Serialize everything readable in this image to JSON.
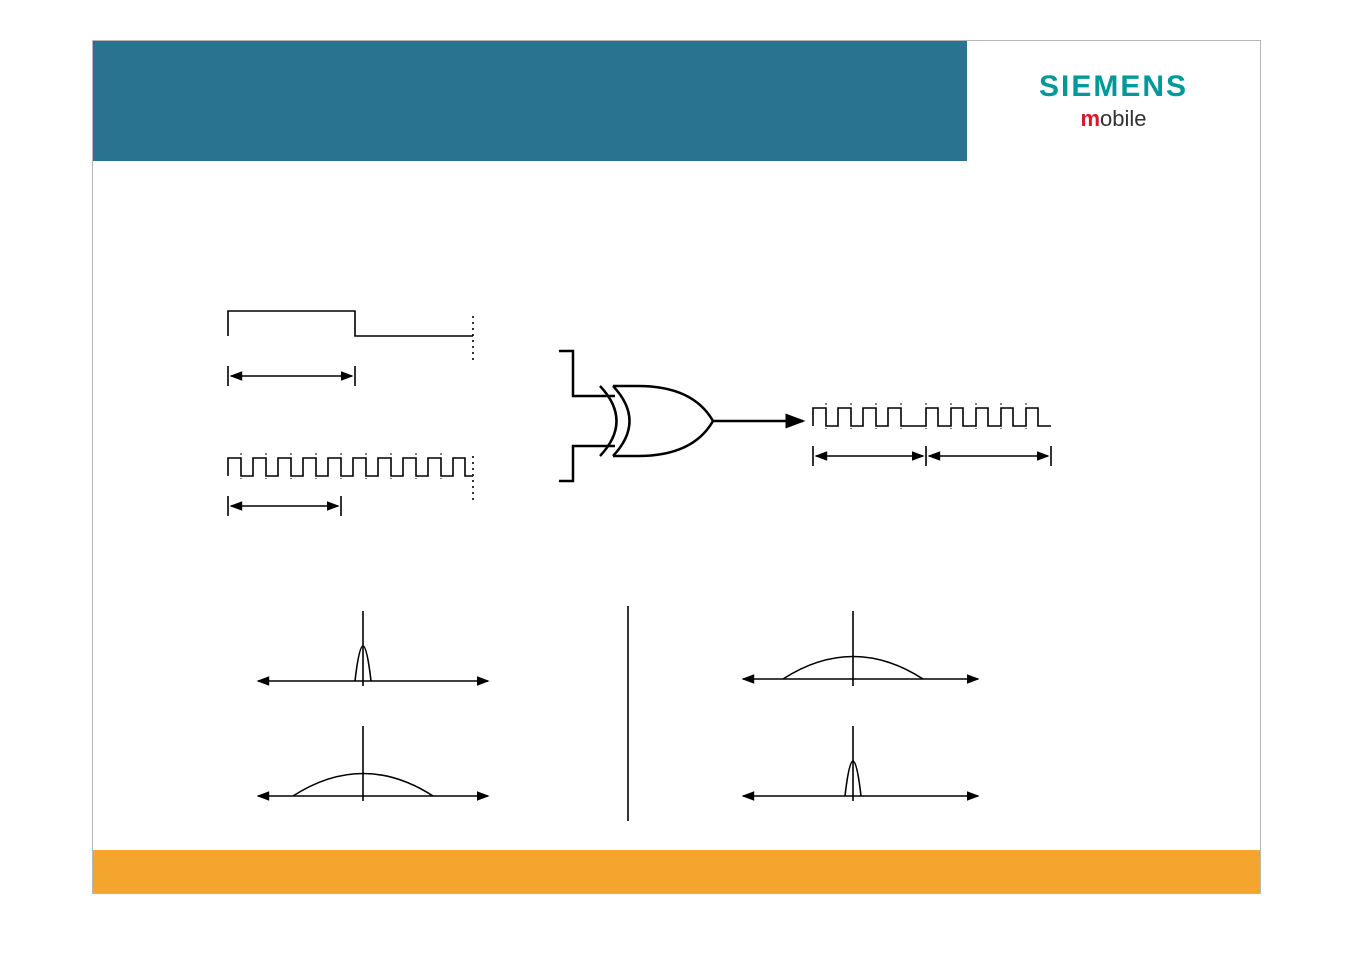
{
  "brand": {
    "line1": "SIEMENS",
    "line2_prefix": "m",
    "line2_rest": "obile"
  },
  "diagram": {
    "description": "Direct-sequence spread spectrum: a slow data bit stream is XORed with a fast chip (code) stream to produce a spread output signal; frequency-domain sketches show narrowband data / wideband code → wideband output, with receiver sketches showing wideband received / narrowband recovered.",
    "signals": {
      "input_top": {
        "role": "data-bits",
        "rate": "slow",
        "approx_chips_per_bit": 10
      },
      "input_bottom": {
        "role": "chip-code",
        "rate": "fast"
      },
      "operation": "XOR",
      "output": {
        "role": "spread-signal",
        "rate": "fast"
      }
    },
    "spectra": {
      "tx_top": "narrowband",
      "tx_bottom": "wideband",
      "rx_top": "wideband",
      "rx_bottom": "narrowband"
    }
  }
}
